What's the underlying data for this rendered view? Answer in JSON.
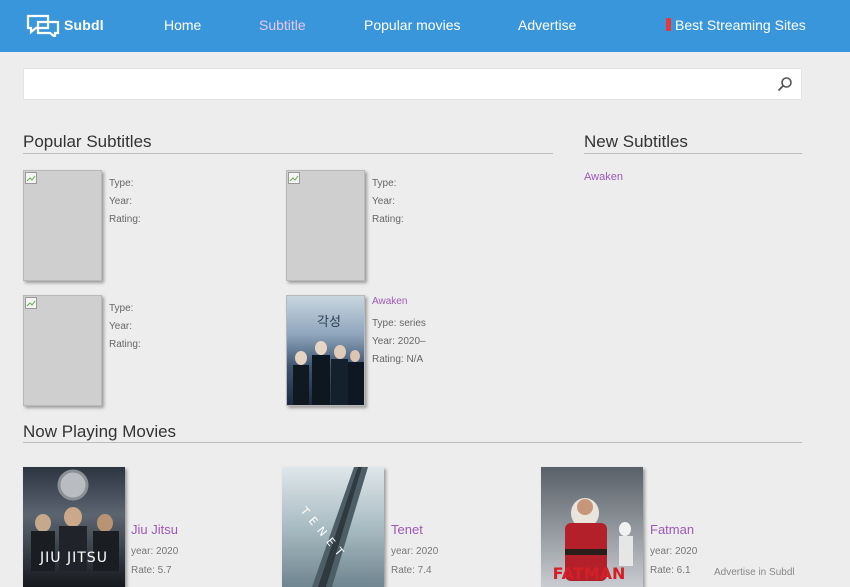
{
  "brand": {
    "name": "Subdl"
  },
  "nav": {
    "items": [
      {
        "label": "Home"
      },
      {
        "label": "Subtitle"
      },
      {
        "label": "Popular movies"
      },
      {
        "label": "Advertise"
      },
      {
        "label": "Best Streaming Sites"
      }
    ],
    "active_index": 1
  },
  "search": {
    "value": "",
    "placeholder": ""
  },
  "popular": {
    "title": "Popular Subtitles",
    "cards": [
      {
        "name": "",
        "type_label": "Type:",
        "year_label": "Year:",
        "rating_label": "Rating:"
      },
      {
        "name": "",
        "type_label": "Type:",
        "year_label": "Year:",
        "rating_label": "Rating:"
      },
      {
        "name": "",
        "type_label": "Type:",
        "year_label": "Year:",
        "rating_label": "Rating:"
      },
      {
        "name": "Awaken",
        "type_label": "Type: series",
        "year_label": "Year: 2020–",
        "rating_label": "Rating: N/A"
      }
    ]
  },
  "new_subtitles": {
    "title": "New Subtitles",
    "items": [
      "Awaken"
    ]
  },
  "now_playing": {
    "title": "Now Playing Movies",
    "movies": [
      {
        "title": "Jiu Jitsu",
        "year": "year: 2020",
        "rate": "Rate: 5.7",
        "poster_text": "JIU JITSU"
      },
      {
        "title": "Tenet",
        "year": "year: 2020",
        "rate": "Rate: 7.4",
        "poster_text": "TENET"
      },
      {
        "title": "Fatman",
        "year": "year: 2020",
        "rate": "Rate: 6.1",
        "poster_text": "FATMAN"
      }
    ]
  },
  "footer": {
    "advert": "Advertise in Subdl"
  },
  "colors": {
    "nav_bg": "#3a96db",
    "link": "#9b59b6",
    "page_bg": "#ededed"
  }
}
